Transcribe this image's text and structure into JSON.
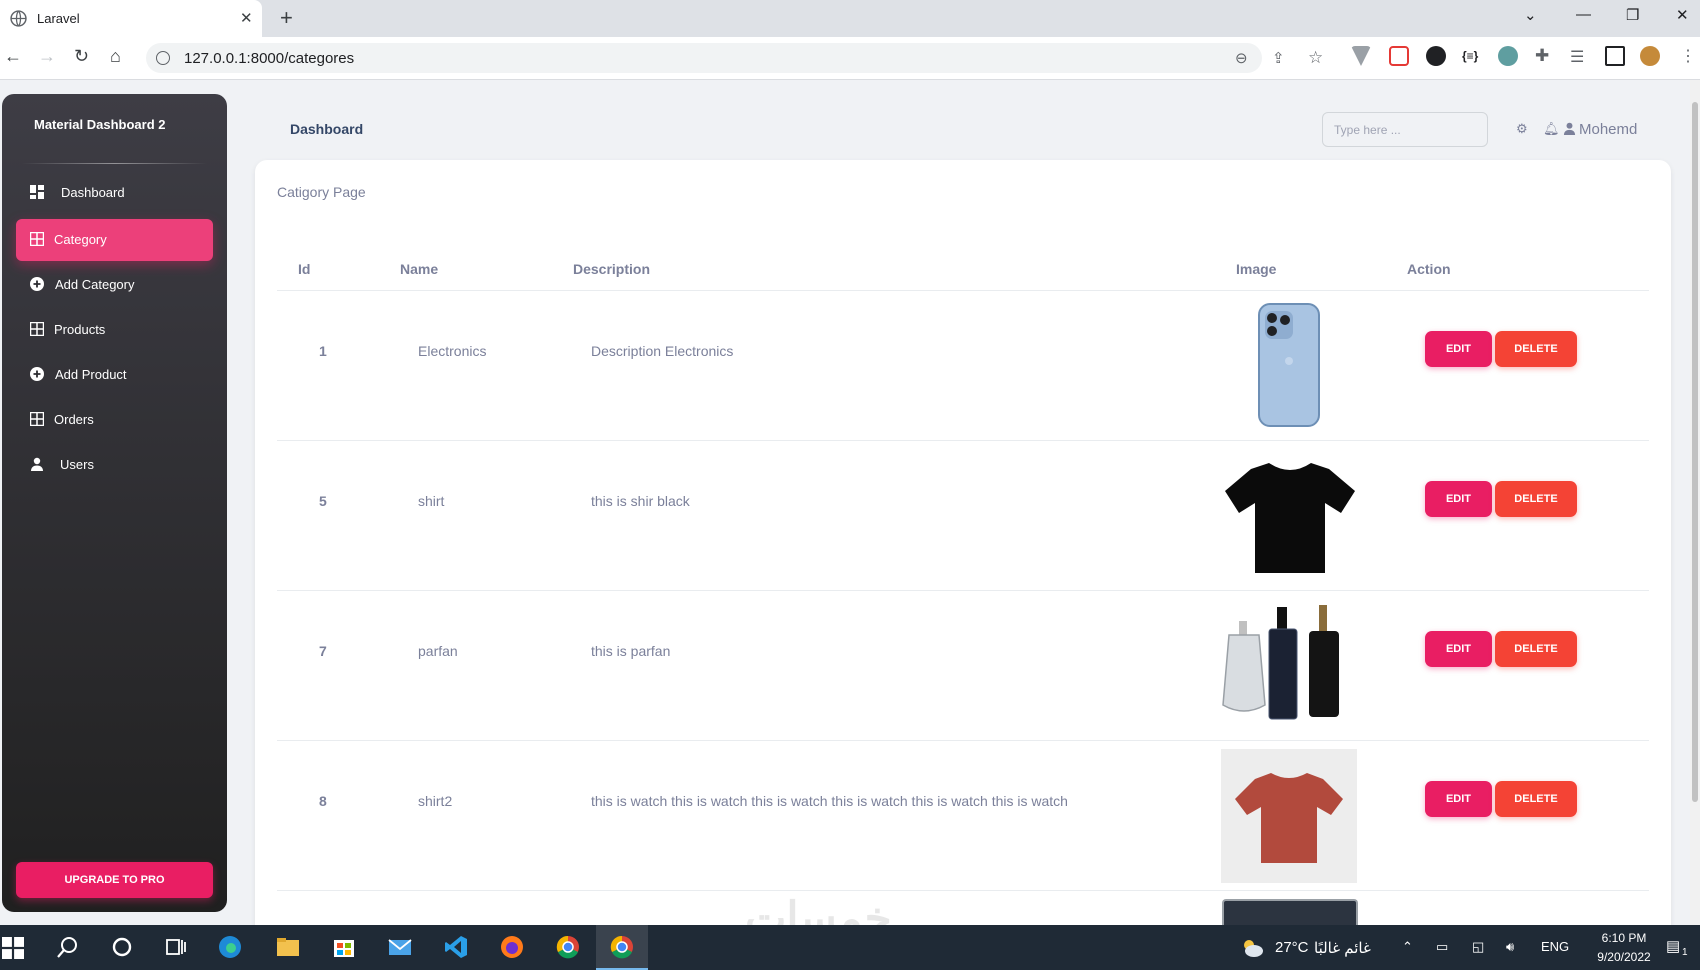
{
  "browser": {
    "tab_title": "Laravel",
    "url": "127.0.0.1:8000/categores"
  },
  "sidebar": {
    "brand": "Material Dashboard 2",
    "items": [
      {
        "label": "Dashboard",
        "icon": "dashboard-icon"
      },
      {
        "label": "Category",
        "icon": "grid-icon",
        "active": true
      },
      {
        "label": "Add Category",
        "icon": "plus-circle-icon"
      },
      {
        "label": "Products",
        "icon": "grid-icon"
      },
      {
        "label": "Add Product",
        "icon": "plus-circle-icon"
      },
      {
        "label": "Orders",
        "icon": "grid-icon"
      },
      {
        "label": "Users",
        "icon": "user-icon"
      }
    ],
    "upgrade_label": "UPGRADE TO PRO"
  },
  "navbar": {
    "title": "Dashboard",
    "search_placeholder": "Type here ...",
    "user": "Mohemd"
  },
  "card": {
    "title": "Catigory Page",
    "columns": [
      "Id",
      "Name",
      "Description",
      "Image",
      "Action"
    ],
    "rows": [
      {
        "id": "1",
        "name": "Electronics",
        "description": "Description Electronics",
        "image": "phone-image",
        "edit": "EDIT",
        "delete": "DELETE"
      },
      {
        "id": "5",
        "name": "shirt",
        "description": "this is shir black",
        "image": "black-tshirt-image",
        "edit": "EDIT",
        "delete": "DELETE"
      },
      {
        "id": "7",
        "name": "parfan",
        "description": "this is parfan",
        "image": "perfume-image",
        "edit": "EDIT",
        "delete": "DELETE"
      },
      {
        "id": "8",
        "name": "shirt2",
        "description": "this is watch this is watch this is watch this is watch this is watch this is watch",
        "image": "red-tshirt-image",
        "edit": "EDIT",
        "delete": "DELETE"
      }
    ]
  },
  "watermark": "خمسات",
  "taskbar": {
    "weather_temp": "27°C",
    "weather_text": "غائم غالبًا",
    "lang": "ENG",
    "time": "6:10 PM",
    "date": "9/20/2022",
    "notifications": "1"
  },
  "colors": {
    "accent": "#e91e63",
    "danger": "#f44335",
    "sidebar_bg": "#2b2b30",
    "text_muted": "#7b809a"
  }
}
